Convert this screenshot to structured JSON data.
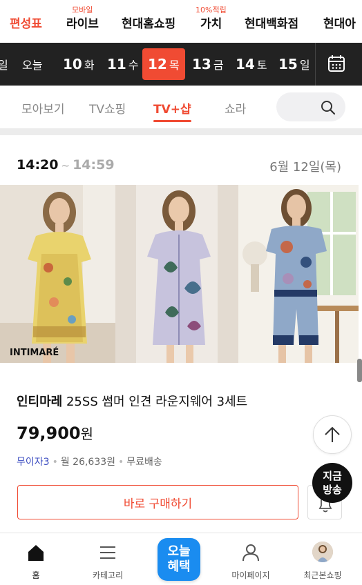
{
  "top_nav": {
    "items": [
      {
        "label": "편성표",
        "active": true
      },
      {
        "label": "라이브",
        "badge": "모바일"
      },
      {
        "label": "현대홈쇼핑"
      },
      {
        "label": "가치",
        "badge": "10%적립"
      },
      {
        "label": "현대백화점"
      },
      {
        "label": "현대아"
      }
    ]
  },
  "date_bar": {
    "days": [
      {
        "num": "",
        "dow": "일"
      },
      {
        "num": "",
        "dow": "오늘"
      },
      {
        "num": "10",
        "dow": "화"
      },
      {
        "num": "11",
        "dow": "수"
      },
      {
        "num": "12",
        "dow": "목",
        "selected": true
      },
      {
        "num": "13",
        "dow": "금"
      },
      {
        "num": "14",
        "dow": "토"
      },
      {
        "num": "15",
        "dow": "일"
      }
    ],
    "calendar_icon": "calendar-icon"
  },
  "category_tabs": {
    "items": [
      {
        "label": "모아보기"
      },
      {
        "label": "TV쇼핑"
      },
      {
        "label": "TV+샵",
        "active": true
      },
      {
        "label": "쇼라"
      }
    ],
    "search_icon": "search-icon"
  },
  "broadcast": {
    "start_time": "14:20",
    "separator": "~",
    "end_time": "14:59",
    "date": "6월 12일(목)",
    "image_logo": "INTIMARÉ",
    "brand": "인티마레",
    "title": "25SS 썸머 인견 라운지웨어 3세트",
    "price": "79,900",
    "price_unit": "원",
    "installment": "무이자3",
    "monthly": "월 26,633원",
    "shipping": "무료배송",
    "buy_label": "바로 구매하기"
  },
  "floating": {
    "scroll_top_icon": "arrow-up-icon",
    "onair_line1": "지금",
    "onair_line2": "방송"
  },
  "bottom_nav": {
    "items": [
      {
        "label": "홈",
        "icon": "home-icon",
        "active": true
      },
      {
        "label": "카테고리",
        "icon": "menu-icon"
      },
      {
        "label": "",
        "icon": "today-benefit-badge"
      },
      {
        "label": "마이페이지",
        "icon": "person-icon"
      },
      {
        "label": "최근본쇼핑",
        "icon": "recent-thumbnail"
      }
    ],
    "today_line1": "오늘",
    "today_line2": "혜택"
  },
  "colors": {
    "accent": "#f04b33",
    "date_bar_bg": "#222222",
    "today_badge": "#1a8cf0"
  }
}
